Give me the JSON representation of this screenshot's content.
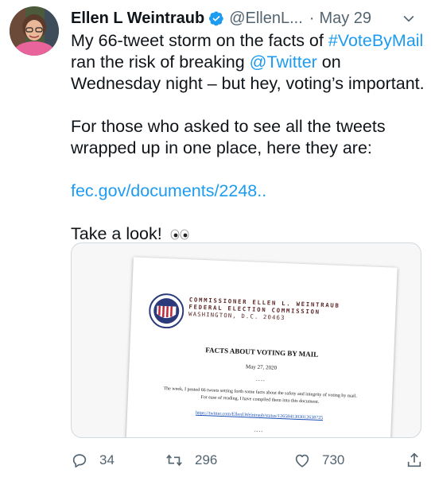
{
  "author": {
    "name": "Ellen L Weintraub",
    "handle": "@EllenL...",
    "separator": "·",
    "date": "May 29"
  },
  "tweet": {
    "para1": {
      "t1": "My 66-tweet storm on the facts of ",
      "hashtag": "#VoteByMail",
      "t2": " ran the risk of breaking ",
      "mention": "@Twitter",
      "t3": " on Wednesday night – but hey, voting’s important."
    },
    "para2": "For those who asked to see all the tweets wrapped up in one place, here they are:",
    "link": "fec.gov/documents/2248..",
    "closing": "Take a look!"
  },
  "document": {
    "commissioner_line1": "COMMISSIONER ELLEN L. WEINTRAUB",
    "commissioner_line2": "FEDERAL ELECTION COMMISSION",
    "commissioner_line3": "WASHINGTON, D.C. 20463",
    "title": "FACTS ABOUT VOTING BY MAIL",
    "date": "May 27, 2020",
    "separator": "....",
    "body_line1": "The week, I posted 66 tweets setting forth some facts about the safety and integrity of voting by mail.",
    "body_line2": "For ease of reading, I have compiled them into this document.",
    "link": "https://twitter.com/EllenLWeintraub/status/1265841303012638725",
    "separator2": "...."
  },
  "actions": {
    "replies": "34",
    "retweets": "296",
    "likes": "730"
  },
  "colors": {
    "accent": "#1d9bf0",
    "secondary_text": "#536471",
    "verified": "#1d9bf0"
  },
  "icons": [
    "verified-badge-icon",
    "chevron-down-icon",
    "eyes-emoji-icon",
    "reply-icon",
    "retweet-icon",
    "like-icon",
    "share-icon"
  ]
}
